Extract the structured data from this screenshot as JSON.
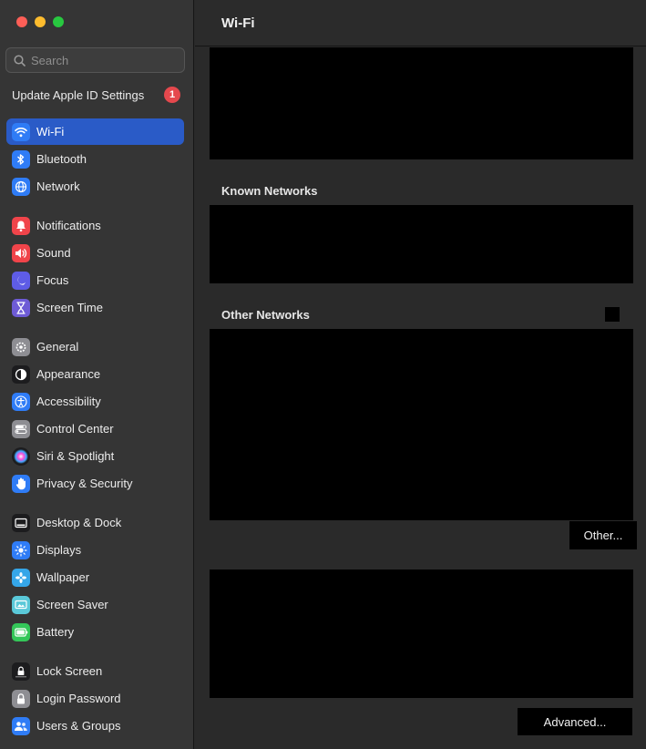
{
  "window": {
    "title": "Wi-Fi"
  },
  "search": {
    "placeholder": "Search"
  },
  "apple_id": {
    "label": "Update Apple ID Settings",
    "badge_count": "1"
  },
  "sidebar": {
    "items": [
      {
        "label": "Wi-Fi",
        "icon": "wifi-icon",
        "color": "#2f7cf6",
        "active": true
      },
      {
        "label": "Bluetooth",
        "icon": "bluetooth-icon",
        "color": "#2f7cf6"
      },
      {
        "label": "Network",
        "icon": "globe-icon",
        "color": "#2f7cf6"
      },
      {
        "label": "Notifications",
        "icon": "bell-icon",
        "color": "#f0444a"
      },
      {
        "label": "Sound",
        "icon": "speaker-icon",
        "color": "#f0444a"
      },
      {
        "label": "Focus",
        "icon": "moon-icon",
        "color": "#5e5ce6"
      },
      {
        "label": "Screen Time",
        "icon": "hourglass-icon",
        "color": "#6e5bd6"
      },
      {
        "label": "General",
        "icon": "gear-icon",
        "color": "#8e8e93"
      },
      {
        "label": "Appearance",
        "icon": "appearance-icon",
        "color": "#1c1c1e"
      },
      {
        "label": "Accessibility",
        "icon": "accessibility-icon",
        "color": "#2f7cf6"
      },
      {
        "label": "Control Center",
        "icon": "control-center-icon",
        "color": "#8e8e93"
      },
      {
        "label": "Siri & Spotlight",
        "icon": "siri-icon",
        "color": "#b03fd8"
      },
      {
        "label": "Privacy & Security",
        "icon": "hand-icon",
        "color": "#2f7cf6"
      },
      {
        "label": "Desktop & Dock",
        "icon": "dock-icon",
        "color": "#1c1c1e"
      },
      {
        "label": "Displays",
        "icon": "sun-icon",
        "color": "#2f7cf6"
      },
      {
        "label": "Wallpaper",
        "icon": "wallpaper-icon",
        "color": "#35a6e8"
      },
      {
        "label": "Screen Saver",
        "icon": "screen-saver-icon",
        "color": "#5ac8d8"
      },
      {
        "label": "Battery",
        "icon": "battery-icon",
        "color": "#34c759"
      },
      {
        "label": "Lock Screen",
        "icon": "lock-screen-icon",
        "color": "#1c1c1e"
      },
      {
        "label": "Login Password",
        "icon": "lock-icon",
        "color": "#8e8e93"
      },
      {
        "label": "Users & Groups",
        "icon": "users-icon",
        "color": "#2f7cf6"
      }
    ]
  },
  "main": {
    "known_networks_label": "Known Networks",
    "other_networks_label": "Other Networks",
    "other_button": "Other...",
    "advanced_button": "Advanced..."
  }
}
